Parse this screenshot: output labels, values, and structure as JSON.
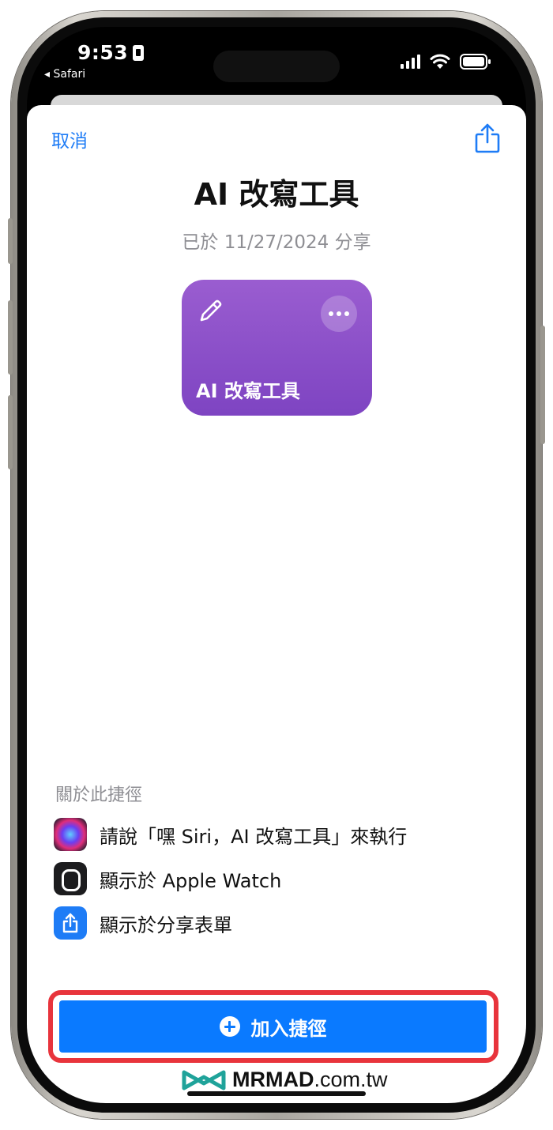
{
  "status_bar": {
    "time": "9:53",
    "back_app": "◂ Safari"
  },
  "sheet": {
    "cancel_label": "取消",
    "title": "AI 改寫工具",
    "shared_date": "已於 11/27/2024 分享"
  },
  "shortcut_tile": {
    "name": "AI 改寫工具",
    "color": "#8a50c9",
    "glyph": "pencil-icon"
  },
  "about": {
    "heading": "關於此捷徑",
    "items": [
      {
        "icon": "siri-icon",
        "label": "請說「嘿 Siri，AI 改寫工具」來執行"
      },
      {
        "icon": "apple-watch-icon",
        "label": "顯示於 Apple Watch"
      },
      {
        "icon": "share-sheet-icon",
        "label": "顯示於分享表單"
      }
    ]
  },
  "add_button": {
    "label": "加入捷徑",
    "color": "#0a7aff",
    "highlight_color": "#e8343c"
  },
  "watermark": {
    "brand": "MRMAD",
    "domain": ".com.tw"
  }
}
